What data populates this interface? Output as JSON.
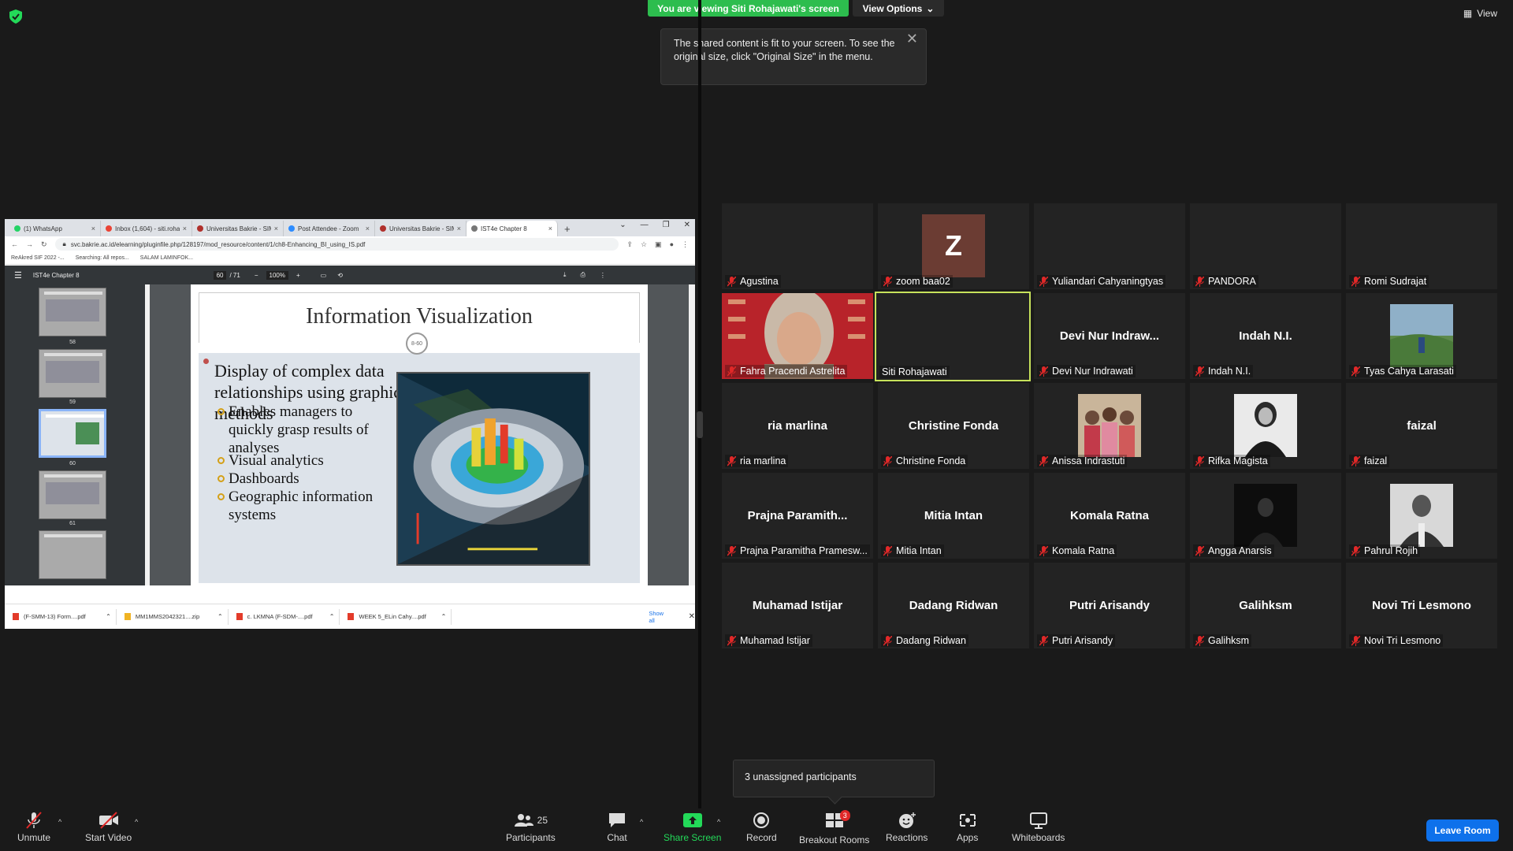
{
  "top": {
    "viewing_banner": "You are viewing Siti Rohajawati's screen",
    "view_options": "View Options",
    "tooltip": "The shared content is fit to your screen. To see the original size, click \"Original Size\" in the menu.",
    "view_button": "View"
  },
  "browser": {
    "tabs": [
      {
        "label": "(1) WhatsApp"
      },
      {
        "label": "Inbox (1,604) - siti.rohaj..."
      },
      {
        "label": "Universitas Bakrie - SIM"
      },
      {
        "label": "Post Attendee - Zoom"
      },
      {
        "label": "Universitas Bakrie - SIM"
      },
      {
        "label": "IST4e Chapter 8"
      }
    ],
    "url": "svc.bakrie.ac.id/elearning/pluginfile.php/128197/mod_resource/content/1/ch8-Enhancing_BI_using_IS.pdf",
    "bookmarks": [
      "ReAkred SIF 2022 -...",
      "Searching: All repos...",
      "SALAM LAMINFOK..."
    ],
    "pdf_title": "IST4e Chapter 8",
    "page_current": "60",
    "page_total": "/ 71",
    "zoom": "100%",
    "thumbnails": [
      "58",
      "59",
      "60",
      "61"
    ],
    "downloads": [
      "(F-SMM-13) Form....pdf",
      "MM1MMS2042321....zip",
      "c. LKMNA (F-SDM-....pdf",
      "WEEK 5_ELin Cahy....pdf"
    ],
    "show_all": "Show all"
  },
  "slide": {
    "title": "Information Visualization",
    "number": "8-60",
    "bullet": "Display of complex data relationships using graphical methods",
    "subbullets": [
      "Enables managers to quickly grasp results of analyses",
      "Visual analytics",
      "Dashboards",
      "Geographic information systems"
    ]
  },
  "participants": [
    {
      "name": "Agustina",
      "display": ""
    },
    {
      "name": "zoom baa02",
      "display": "Z"
    },
    {
      "name": "Yuliandari Cahyaningtyas",
      "display": ""
    },
    {
      "name": "PANDORA",
      "display": ""
    },
    {
      "name": "Romi Sudrajat",
      "display": ""
    },
    {
      "name": "Fahra Pracendi Astrelita",
      "display": ""
    },
    {
      "name": "Siti Rohajawati",
      "display": ""
    },
    {
      "name": "Devi Nur Indrawati",
      "display": "Devi Nur Indraw..."
    },
    {
      "name": "Indah N.I.",
      "display": "Indah N.I."
    },
    {
      "name": "Tyas Cahya Larasati",
      "display": ""
    },
    {
      "name": "ria marlina",
      "display": "ria marlina"
    },
    {
      "name": "Christine Fonda",
      "display": "Christine Fonda"
    },
    {
      "name": "Anissa Indrastuti",
      "display": ""
    },
    {
      "name": "Rifka Magista",
      "display": ""
    },
    {
      "name": "faizal",
      "display": "faizal"
    },
    {
      "name": "Prajna Paramitha Pramesw...",
      "display": "Prajna Paramith..."
    },
    {
      "name": "Mitia Intan",
      "display": "Mitia Intan"
    },
    {
      "name": "Komala Ratna",
      "display": "Komala Ratna"
    },
    {
      "name": "Angga Anarsis",
      "display": ""
    },
    {
      "name": "Pahrul Rojih",
      "display": ""
    },
    {
      "name": "Muhamad Istijar",
      "display": "Muhamad Istijar"
    },
    {
      "name": "Dadang Ridwan",
      "display": "Dadang Ridwan"
    },
    {
      "name": "Putri Arisandy",
      "display": "Putri Arisandy"
    },
    {
      "name": "Galihksm",
      "display": "Galihksm"
    },
    {
      "name": "Novi Tri Lesmono",
      "display": "Novi Tri Lesmono"
    }
  ],
  "popover": {
    "text": "3 unassigned participants"
  },
  "toolbar": {
    "unmute": "Unmute",
    "start_video": "Start Video",
    "participants": "Participants",
    "participants_count": "25",
    "chat": "Chat",
    "share_screen": "Share Screen",
    "record": "Record",
    "breakout_rooms": "Breakout Rooms",
    "breakout_count": "3",
    "reactions": "Reactions",
    "apps": "Apps",
    "whiteboards": "Whiteboards",
    "leave": "Leave Room"
  },
  "colors": {
    "accent_green": "#23d959",
    "leave_blue": "#0e71eb",
    "active_speaker": "#c7e25b",
    "mute_red": "#e02828"
  }
}
